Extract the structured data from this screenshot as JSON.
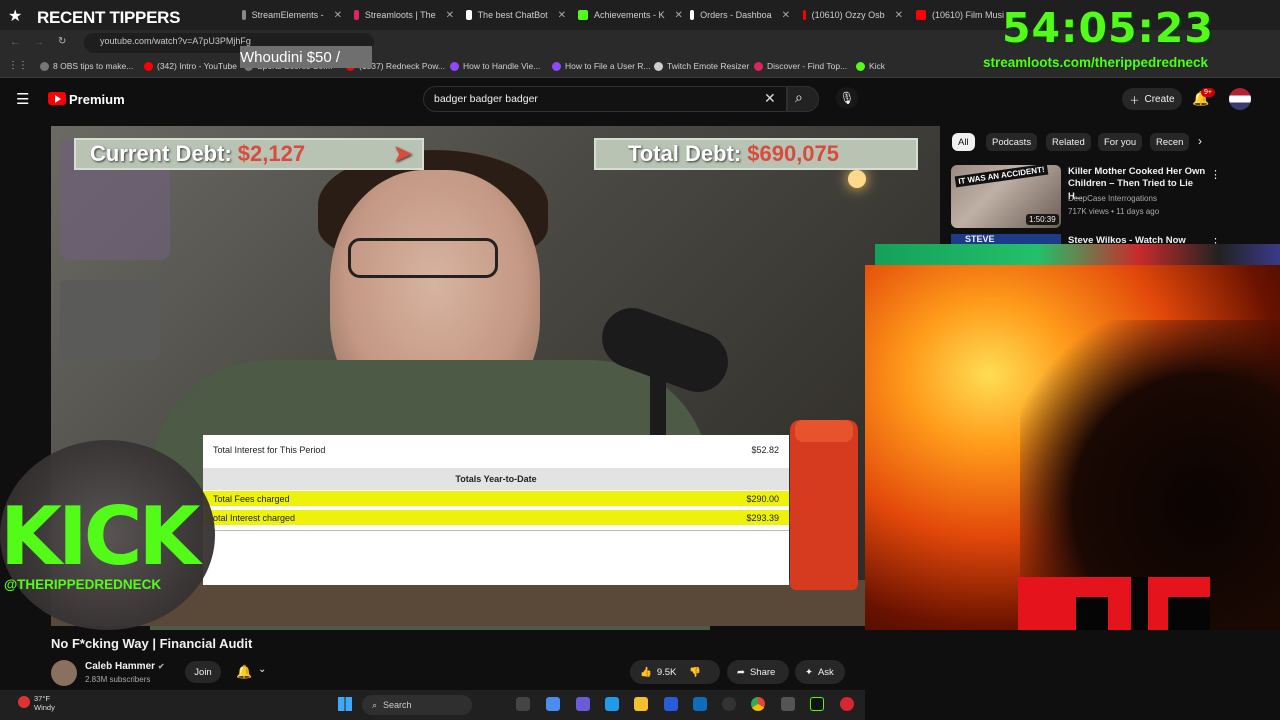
{
  "overlay": {
    "recent_tippers": "RECENT TIPPERS",
    "tip_line": "Whoudini $50 /",
    "timer": "54:05:23",
    "timer_url": "streamloots.com/therippedredneck",
    "kick_logo": "KICK",
    "kick_handle": "@THERIPPEDREDNECK"
  },
  "browser": {
    "tabs": [
      {
        "label": "StreamElements -",
        "color": "#8a8a8a"
      },
      {
        "label": "Streamloots | The",
        "color": "#e0245e"
      },
      {
        "label": "The best ChatBot",
        "color": "#ffffff"
      },
      {
        "label": "Achievements - K",
        "color": "#53fc18"
      },
      {
        "label": "Orders - Dashboa",
        "color": "#ffffff"
      },
      {
        "label": "(10610) Ozzy Osb",
        "color": "#ff0000"
      },
      {
        "label": "(10610) Film Musi",
        "color": "#ff0000"
      }
    ],
    "url": "youtube.com/watch?v=A7pU3PMjhFg",
    "bookmarks": [
      {
        "label": "8 OBS tips to make...",
        "color": "#777"
      },
      {
        "label": "(342) Intro - YouTube",
        "color": "#ff0000"
      },
      {
        "label": "Sports Scores Sof...",
        "color": "#777"
      },
      {
        "label": "(1837) Redneck Pow...",
        "color": "#ff0000"
      },
      {
        "label": "How to Handle Vie...",
        "color": "#9146ff"
      },
      {
        "label": "How to File a User R...",
        "color": "#9146ff"
      },
      {
        "label": "Twitch Emote Resizer",
        "color": "#ccc"
      },
      {
        "label": "Discover - Find Top...",
        "color": "#e0245e"
      },
      {
        "label": "Kick",
        "color": "#53fc18"
      }
    ]
  },
  "youtube": {
    "logo_text": "Premium",
    "search_value": "badger badger badger",
    "create_label": "Create",
    "notif_count": "9+",
    "chips": [
      "All",
      "Podcasts",
      "Related",
      "For you",
      "Recen"
    ],
    "rec1": {
      "title": "Killer Mother Cooked Her Own Children – Then Tried to Lie H...",
      "channel": "DeepCase Interrogations",
      "meta": "717K views • 11 days ago",
      "duration": "1:50:39",
      "thumb_text": "IT WAS AN ACCIDENT!"
    },
    "rec2": {
      "title": "Steve Wilkos - Watch Now",
      "thumb_text": "STEVE"
    },
    "video_title": "No F*cking Way | Financial Audit",
    "channel_name": "Caleb Hammer",
    "subscribers": "2.83M subscribers",
    "join_label": "Join",
    "likes": "9.5K",
    "share_label": "Share",
    "ask_label": "Ask"
  },
  "video_overlay": {
    "current_debt_label": "Current Debt:",
    "current_debt_value": "$2,127",
    "total_debt_label": "Total Debt:",
    "total_debt_value": "$690,075",
    "statement": {
      "interest_period_label": "Total Interest for This Period",
      "interest_period_value": "$52.82",
      "ytd_header": "Totals Year-to-Date",
      "fees_label": "Total Fees charged",
      "fees_value": "$290.00",
      "interest_label": "otal Interest charged",
      "interest_value": "$293.39"
    }
  },
  "taskbar": {
    "temp": "37°F",
    "condition": "Windy",
    "search_label": "Search"
  }
}
